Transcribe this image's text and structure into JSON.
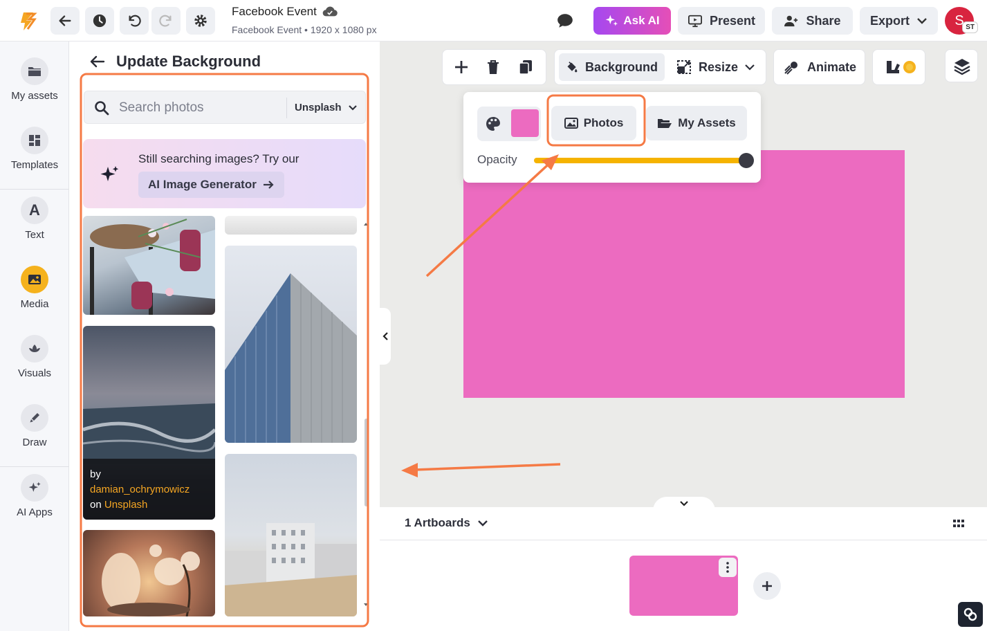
{
  "header": {
    "doc_title": "Facebook Event",
    "doc_subtitle": "Facebook Event • 1920 x 1080 px",
    "ask_ai_label": "Ask AI",
    "present_label": "Present",
    "share_label": "Share",
    "export_label": "Export",
    "avatar_initial": "S",
    "avatar_badge": "ST"
  },
  "rail": {
    "items": [
      {
        "label": "My assets",
        "icon": "folder-icon"
      },
      {
        "label": "Templates",
        "icon": "templates-icon"
      },
      {
        "label": "Text",
        "icon": "text-icon"
      },
      {
        "label": "Media",
        "icon": "media-icon"
      },
      {
        "label": "Visuals",
        "icon": "visuals-icon"
      },
      {
        "label": "Draw",
        "icon": "draw-icon"
      },
      {
        "label": "AI Apps",
        "icon": "ai-apps-icon"
      }
    ]
  },
  "panel": {
    "title": "Update Background",
    "search_placeholder": "Search photos",
    "search_source": "Unsplash",
    "promo_text": "Still searching images? Try our",
    "promo_button": "AI Image Generator",
    "credit_by": "by",
    "credit_author": "damian_ochrymowicz",
    "credit_on": "on",
    "credit_site": "Unsplash"
  },
  "toolbar": {
    "background_label": "Background",
    "resize_label": "Resize",
    "animate_label": "Animate"
  },
  "popover": {
    "photos_label": "Photos",
    "assets_label": "My Assets",
    "opacity_label": "Opacity",
    "opacity_value": 1.0,
    "color": "#ec6bc0"
  },
  "bottom": {
    "artboards_label": "1 Artboards"
  },
  "colors": {
    "accent_orange": "#f57a45",
    "artboard_pink": "#ec6bc0",
    "active_yellow": "#f5b21d"
  }
}
